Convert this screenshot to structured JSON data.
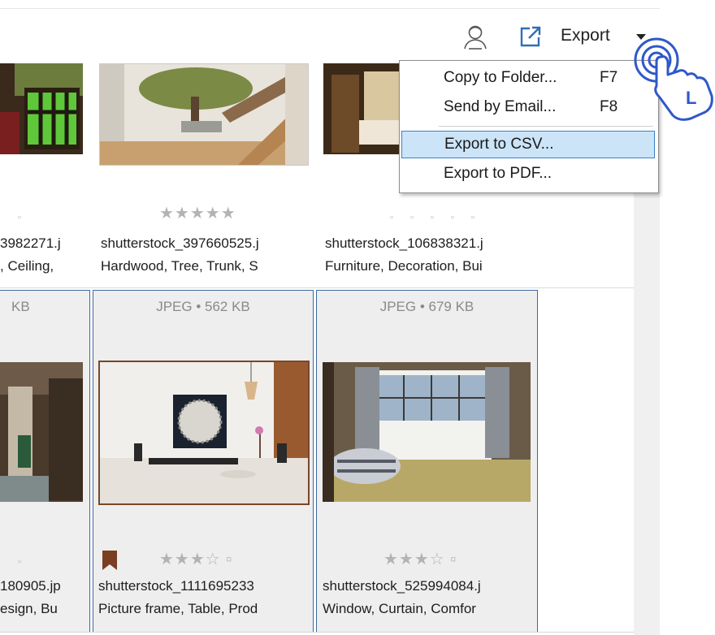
{
  "toolbar": {
    "export_label": "Export",
    "icons": [
      "face-recognition-icon",
      "export-icon",
      "caret-down-icon"
    ]
  },
  "export_menu": {
    "items": [
      {
        "label": "Copy to Folder...",
        "shortcut": "F7",
        "selected": false
      },
      {
        "label": "Send by Email...",
        "shortcut": "F8",
        "selected": false
      },
      {
        "label": "Export to CSV...",
        "shortcut": "",
        "selected": true
      },
      {
        "label": "Export to PDF...",
        "shortcut": "",
        "selected": false
      }
    ]
  },
  "gallery": {
    "row1": [
      {
        "rating": "▫",
        "name": "3982271.j",
        "tags": ", Ceiling,"
      },
      {
        "rating": "★★★★★",
        "name": "shutterstock_397660525.j",
        "tags": "Hardwood, Tree, Trunk, S"
      },
      {
        "rating": "▫ ▫ ▫ ▫ ▫",
        "name": "shutterstock_106838321.j",
        "tags": "Furniture, Decoration, Bui"
      }
    ],
    "row2": [
      {
        "meta": "KB",
        "rating": "▫",
        "name": "180905.jp",
        "tags": "esign, Bu"
      },
      {
        "meta": "JPEG • 562 KB",
        "rating": "★★★☆ ▫",
        "name": "shutterstock_1111695233",
        "tags": "Picture frame, Table, Prod",
        "bookmarked": true
      },
      {
        "meta": "JPEG • 679 KB",
        "rating": "★★★☆ ▫",
        "name": "shutterstock_525994084.j",
        "tags": "Window, Curtain, Comfor"
      }
    ]
  },
  "overlay": {
    "hand_letter": "L"
  },
  "colors": {
    "selection": "#cce4f7",
    "card_border": "#3d6a9e",
    "export_icon": "#2f6fb4",
    "hand": "#2f58c9"
  }
}
